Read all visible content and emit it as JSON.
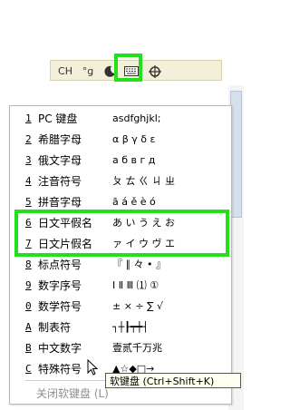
{
  "ime_toolbar": {
    "lang_label": "CH",
    "punct_label": "°g",
    "moon_icon": "moon-icon",
    "keyboard_icon": "keyboard-icon",
    "menu_icon": "tools-icon"
  },
  "menu": {
    "items": [
      {
        "key": "1",
        "label": "PC 键盘",
        "preview": "asdfghjkl;"
      },
      {
        "key": "2",
        "label": "希腊字母",
        "preview": "α β γ δ ε"
      },
      {
        "key": "3",
        "label": "俄文字母",
        "preview": "а б в г д"
      },
      {
        "key": "4",
        "label": "注音符号",
        "preview": "ㄆ ㄊ ㄍ ㄐ ㄓ"
      },
      {
        "key": "5",
        "label": "拼音字母",
        "preview": "ā á ě è ó"
      },
      {
        "key": "6",
        "label": "日文平假名",
        "preview": "あ い う え お"
      },
      {
        "key": "7",
        "label": "日文片假名",
        "preview": "ァ イ ウ ヴ エ"
      },
      {
        "key": "8",
        "label": "标点符号",
        "preview": "『 ∥ 々 • 』"
      },
      {
        "key": "9",
        "label": "数字序号",
        "preview": "Ⅰ Ⅱ Ⅲ ⑴ ①"
      },
      {
        "key": "0",
        "label": "数学符号",
        "preview": "± × ÷ ∑ √"
      },
      {
        "key": "A",
        "label": "制表符",
        "preview": "┐┼┠┯┿┤"
      },
      {
        "key": "B",
        "label": "中文数字",
        "preview": "壹贰千万兆"
      },
      {
        "key": "C",
        "label": "特殊符号",
        "preview": "▲☆◆□→"
      }
    ],
    "close_label": "关闭软键盘 (L)"
  },
  "tooltip": "软键盘 (Ctrl+Shift+K)"
}
